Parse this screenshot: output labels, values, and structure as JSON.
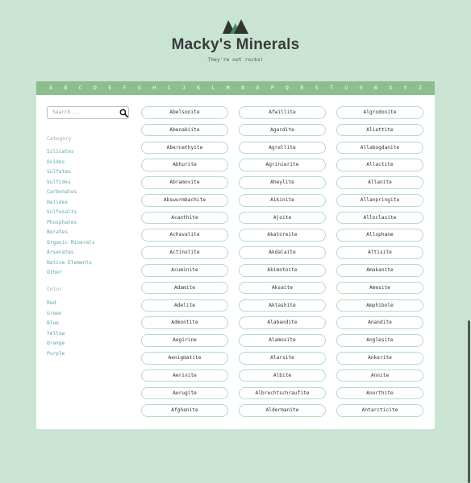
{
  "header": {
    "title": "Macky's Minerals",
    "tagline": "They're not rocks!"
  },
  "alphabet": [
    "A",
    "B",
    "C",
    "D",
    "E",
    "F",
    "G",
    "H",
    "I",
    "J",
    "K",
    "L",
    "M",
    "N",
    "O",
    "P",
    "Q",
    "R",
    "S",
    "T",
    "U",
    "V",
    "W",
    "X",
    "Y",
    "Z"
  ],
  "search": {
    "placeholder": "Search..."
  },
  "filters": {
    "category_heading": "Category",
    "categories": [
      "Silicates",
      "Oxides",
      "Sulfates",
      "Sulfides",
      "Carbonates",
      "Halides",
      "Sulfosalts",
      "Phosphates",
      "Borates",
      "Organic Minerals",
      "Arsenates",
      "Native Elements",
      "Other"
    ],
    "color_heading": "Color",
    "colors": [
      "Red",
      "Green",
      "Blue",
      "Yellow",
      "Orange",
      "Purple"
    ]
  },
  "minerals": {
    "col1": [
      "Abelsonite",
      "Abenakiite",
      "Abernathyite",
      "Abhurite",
      "Abramovite",
      "Abswurmbachite",
      "Acanthite",
      "Achavalite",
      "Actinolite",
      "Acuminite",
      "Adamite",
      "Adelite",
      "Admontite",
      "Aegirine",
      "Aenigmatite",
      "Aerinite",
      "Aerugite",
      "Afghanite"
    ],
    "col2": [
      "Afwillite",
      "Agardite",
      "Agrellite",
      "Agrinierite",
      "Aheylite",
      "Aikinite",
      "Ajoite",
      "Akatoreite",
      "Akdalaite",
      "Akimotoite",
      "Aksaite",
      "Aktashite",
      "Alabandite",
      "Alamosite",
      "Alarsite",
      "Albite",
      "Albrechtschraufite",
      "Aldermanite"
    ],
    "col3": [
      "Algrodonite",
      "Aliettite",
      "Allabogdanite",
      "Allactite",
      "Allanite",
      "Allanpringite",
      "Alloclasite",
      "Allophane",
      "Altisite",
      "Amakanite",
      "Amesite",
      "Amphibole",
      "Anandite",
      "Anglesite",
      "Ankerite",
      "Annite",
      "Anorthite",
      "Antarcticite"
    ]
  },
  "colors": {
    "background": "#c9e4d3",
    "accent": "#8cbf8f",
    "link": "#5aa5a8",
    "pill_border": "#b5dcc0"
  },
  "icons": {
    "logo": "mineral-crystals-icon",
    "search": "search-icon"
  }
}
